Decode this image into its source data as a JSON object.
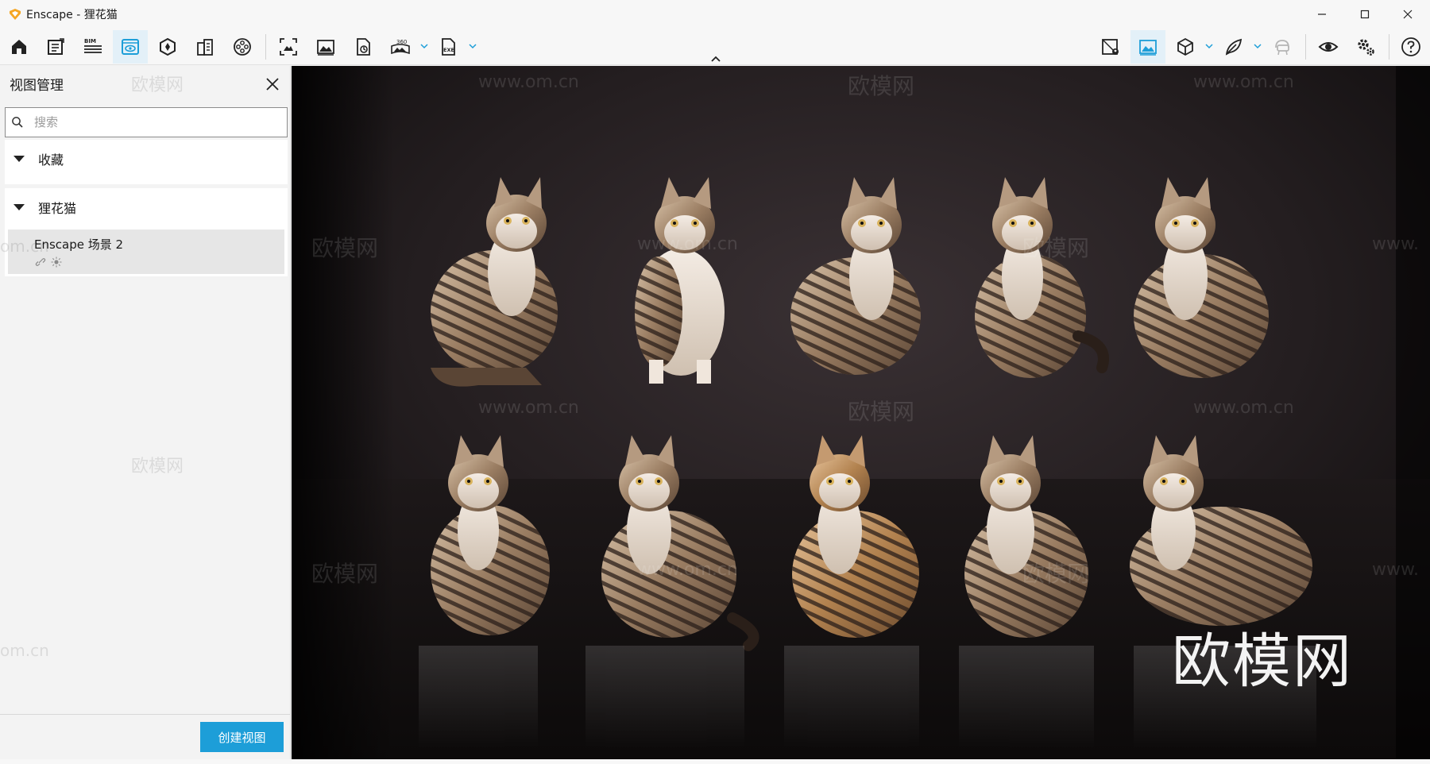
{
  "window": {
    "title": "Enscape - 狸花猫",
    "brand_color": "#f5a623"
  },
  "toolbar": {
    "left_icons": [
      "home-icon",
      "notes-icon",
      "bim-icon",
      "view-management-icon",
      "settings-3d-icon",
      "building-icon",
      "video-reel-icon",
      "screenshot-icon",
      "image-icon",
      "batch-render-icon",
      "panorama-360-icon",
      "exe-export-icon"
    ],
    "right_icons": [
      "map-pin-icon",
      "image-view-icon",
      "cube-icon",
      "asset-library-icon",
      "vr-headset-icon",
      "eye-icon",
      "gear-icon",
      "help-icon"
    ],
    "bim_label": "BIM",
    "pano_label": "360",
    "exe_label": "EXE",
    "active_color": "#1d9ed8"
  },
  "sidebar": {
    "title": "视图管理",
    "search_placeholder": "搜索",
    "groups": [
      {
        "label": "收藏"
      },
      {
        "label": "狸花猫"
      }
    ],
    "view_item": {
      "name": "Enscape 场景 2",
      "icons": [
        "link-icon",
        "sun-icon"
      ]
    },
    "create_button": "创建视图"
  },
  "viewport": {
    "logo_text": "欧模网",
    "watermark_site": "www.om.cn",
    "watermark_brand": "欧模网",
    "watermark_partial": "om.cn",
    "watermark_partial_www": "www."
  }
}
